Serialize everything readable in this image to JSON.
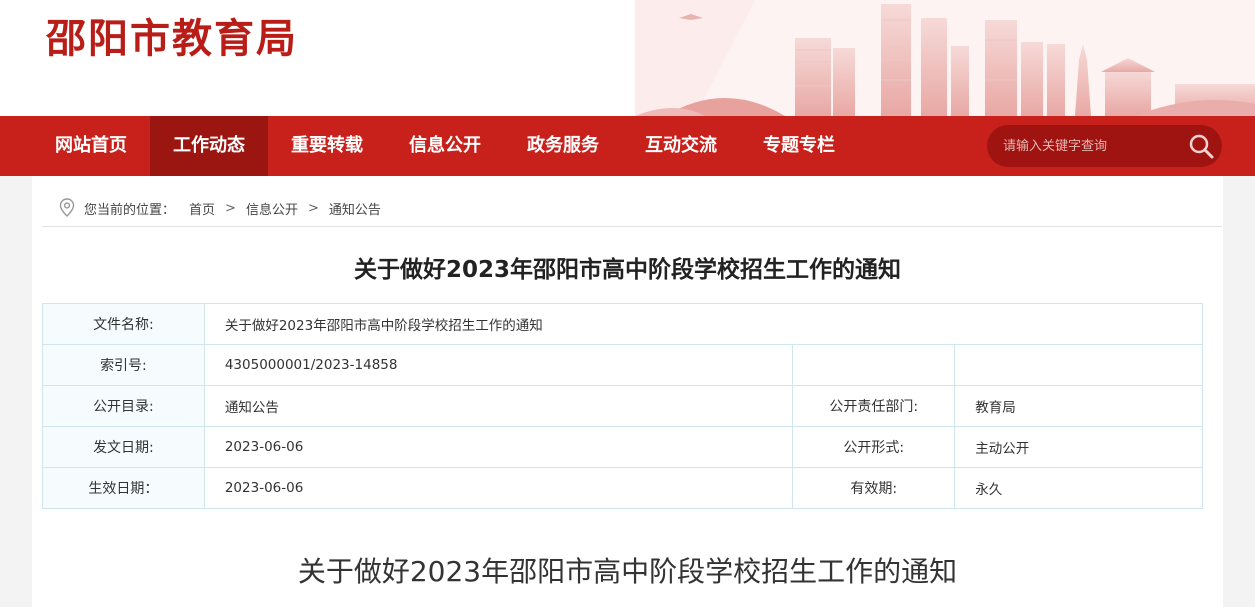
{
  "site": {
    "title": "邵阳市教育局"
  },
  "nav": {
    "items": [
      "网站首页",
      "工作动态",
      "重要转载",
      "信息公开",
      "政务服务",
      "互动交流",
      "专题专栏"
    ],
    "active": "工作动态"
  },
  "search": {
    "placeholder": "请输入关键字查询"
  },
  "breadcrumb": {
    "prefix": "您当前的位置：",
    "items": [
      "首页",
      "信息公开",
      "通知公告"
    ],
    "separator": ">"
  },
  "article": {
    "title": "关于做好2023年邵阳市高中阶段学校招生工作的通知",
    "body_title": "关于做好2023年邵阳市高中阶段学校招生工作的通知"
  },
  "meta": {
    "file_name_label": "文件名称:",
    "file_name": "关于做好2023年邵阳市高中阶段学校招生工作的通知",
    "index_label": "索引号:",
    "index": "4305000001/2023-14858",
    "catalog_label": "公开目录:",
    "catalog": "通知公告",
    "dept_label": "公开责任部门:",
    "dept": "教育局",
    "issue_date_label": "发文日期:",
    "issue_date": "2023-06-06",
    "form_label": "公开形式:",
    "form": "主动公开",
    "effective_label": "生效日期：",
    "effective": "2023-06-06",
    "validity_label": "有效期:",
    "validity": "永久"
  },
  "colors": {
    "brand_red": "#c8201b",
    "active_red": "#9b1511",
    "title_red": "#b81d18",
    "table_border": "#cfe6ef"
  }
}
